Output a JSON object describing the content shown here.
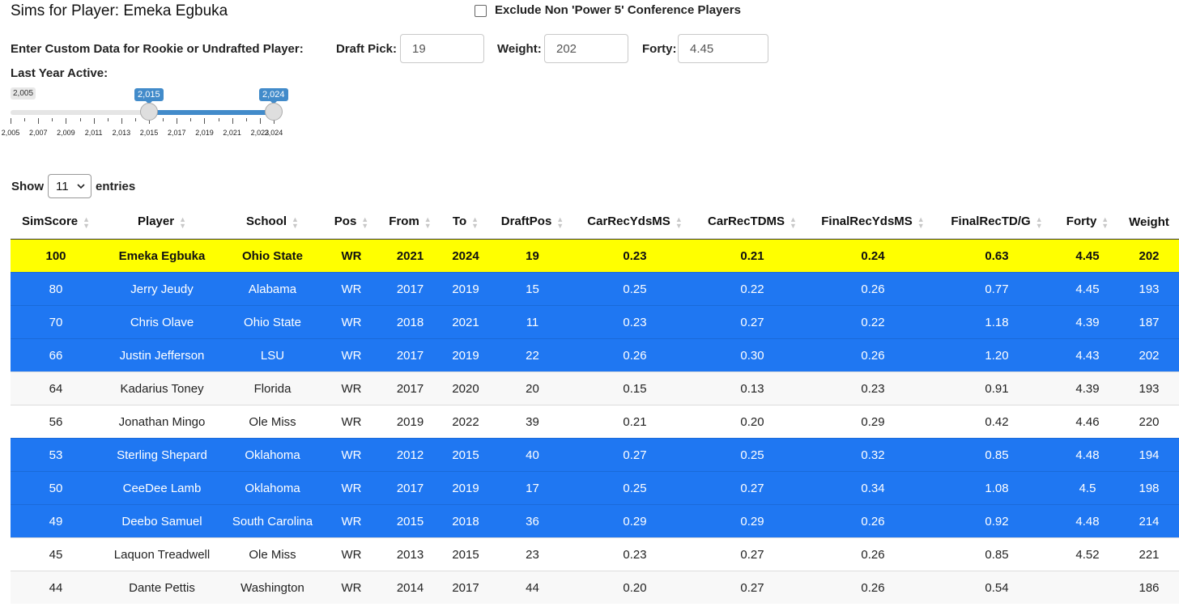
{
  "title": "Sims for Player: Emeka Egbuka",
  "exclude_label": "Exclude Non 'Power 5' Conference Players",
  "custom_label": "Enter Custom Data for Rookie or Undrafted Player:",
  "fields": {
    "draft_pick_label": "Draft Pick:",
    "draft_pick_value": "19",
    "weight_label": "Weight:",
    "weight_value": "202",
    "forty_label": "Forty:",
    "forty_value": "4.45"
  },
  "slider": {
    "label": "Last Year Active:",
    "min_label": "2,005",
    "low_label": "2,015",
    "high_label": "2,024",
    "min": 2005,
    "max": 2024,
    "low": 2015,
    "high": 2024,
    "tick_labels": [
      "2,005",
      "2,007",
      "2,009",
      "2,011",
      "2,013",
      "2,015",
      "2,017",
      "2,019",
      "2,021",
      "2,023",
      "2,024"
    ]
  },
  "length": {
    "show": "Show",
    "value": "11",
    "entries": "entries"
  },
  "table": {
    "columns": [
      "SimScore",
      "Player",
      "School",
      "Pos",
      "From",
      "To",
      "DraftPos",
      "CarRecYdsMS",
      "CarRecTDMS",
      "FinalRecYdsMS",
      "FinalRecTD/G",
      "Forty",
      "Weight"
    ],
    "rows": [
      {
        "style": "yellow",
        "cells": [
          "100",
          "Emeka Egbuka",
          "Ohio State",
          "WR",
          "2021",
          "2024",
          "19",
          "0.23",
          "0.21",
          "0.24",
          "0.63",
          "4.45",
          "202"
        ]
      },
      {
        "style": "blue",
        "cells": [
          "80",
          "Jerry Jeudy",
          "Alabama",
          "WR",
          "2017",
          "2019",
          "15",
          "0.25",
          "0.22",
          "0.26",
          "0.77",
          "4.45",
          "193"
        ]
      },
      {
        "style": "blue",
        "cells": [
          "70",
          "Chris Olave",
          "Ohio State",
          "WR",
          "2018",
          "2021",
          "11",
          "0.23",
          "0.27",
          "0.22",
          "1.18",
          "4.39",
          "187"
        ]
      },
      {
        "style": "blue",
        "cells": [
          "66",
          "Justin Jefferson",
          "LSU",
          "WR",
          "2017",
          "2019",
          "22",
          "0.26",
          "0.30",
          "0.26",
          "1.20",
          "4.43",
          "202"
        ]
      },
      {
        "style": "gray",
        "cells": [
          "64",
          "Kadarius Toney",
          "Florida",
          "WR",
          "2017",
          "2020",
          "20",
          "0.15",
          "0.13",
          "0.23",
          "0.91",
          "4.39",
          "193"
        ]
      },
      {
        "style": "white",
        "cells": [
          "56",
          "Jonathan Mingo",
          "Ole Miss",
          "WR",
          "2019",
          "2022",
          "39",
          "0.21",
          "0.20",
          "0.29",
          "0.42",
          "4.46",
          "220"
        ]
      },
      {
        "style": "blue",
        "cells": [
          "53",
          "Sterling Shepard",
          "Oklahoma",
          "WR",
          "2012",
          "2015",
          "40",
          "0.27",
          "0.25",
          "0.32",
          "0.85",
          "4.48",
          "194"
        ]
      },
      {
        "style": "blue",
        "cells": [
          "50",
          "CeeDee Lamb",
          "Oklahoma",
          "WR",
          "2017",
          "2019",
          "17",
          "0.25",
          "0.27",
          "0.34",
          "1.08",
          "4.5",
          "198"
        ]
      },
      {
        "style": "blue",
        "cells": [
          "49",
          "Deebo Samuel",
          "South Carolina",
          "WR",
          "2015",
          "2018",
          "36",
          "0.29",
          "0.29",
          "0.26",
          "0.92",
          "4.48",
          "214"
        ]
      },
      {
        "style": "white",
        "cells": [
          "45",
          "Laquon Treadwell",
          "Ole Miss",
          "WR",
          "2013",
          "2015",
          "23",
          "0.23",
          "0.27",
          "0.26",
          "0.85",
          "4.52",
          "221"
        ]
      },
      {
        "style": "gray",
        "cells": [
          "44",
          "Dante Pettis",
          "Washington",
          "WR",
          "2014",
          "2017",
          "44",
          "0.20",
          "0.27",
          "0.26",
          "0.54",
          "",
          "186"
        ]
      }
    ]
  }
}
